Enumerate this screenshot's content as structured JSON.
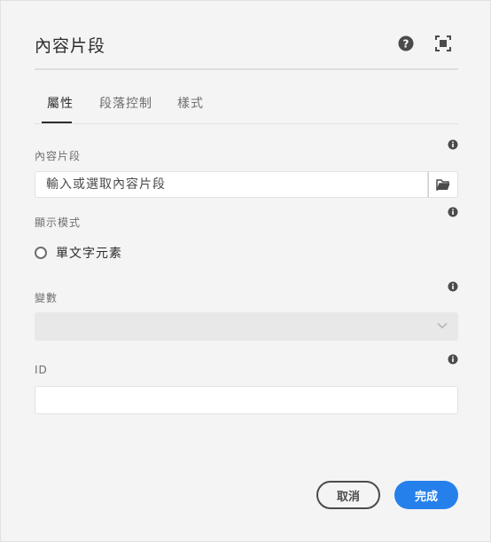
{
  "dialog": {
    "title": "內容片段",
    "help_icon": "help-circle-icon",
    "fullscreen_icon": "fullscreen-icon"
  },
  "tabs": [
    {
      "label": "屬性",
      "active": true
    },
    {
      "label": "段落控制",
      "active": false
    },
    {
      "label": "樣式",
      "active": false
    }
  ],
  "fields": {
    "content_fragment": {
      "label": "內容片段",
      "placeholder": "輸入或選取內容片段",
      "browse_icon": "folder-icon"
    },
    "display_mode": {
      "label": "顯示模式",
      "option": "單文字元素"
    },
    "variation": {
      "label": "變數",
      "value": ""
    },
    "id": {
      "label": "ID",
      "value": ""
    }
  },
  "footer": {
    "cancel_label": "取消",
    "done_label": "完成"
  },
  "colors": {
    "accent": "#2680eb",
    "background": "#f4f4f4"
  }
}
